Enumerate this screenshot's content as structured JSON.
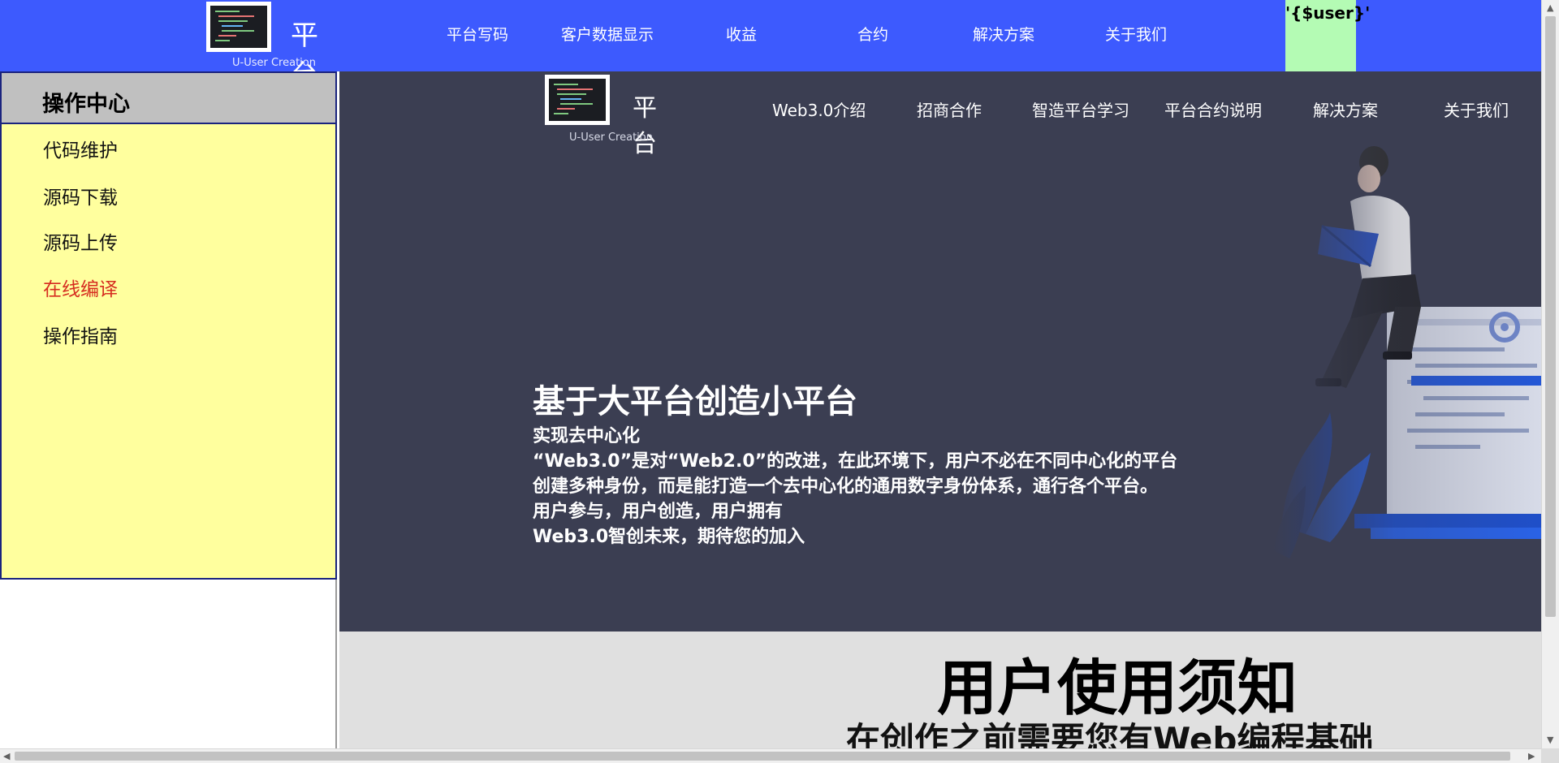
{
  "topbar": {
    "logo": {
      "title": "平台",
      "subtitle": "U-User Creation"
    },
    "nav": [
      {
        "label": "平台写码"
      },
      {
        "label": "客户数据显示"
      },
      {
        "label": "收益"
      },
      {
        "label": "合约"
      },
      {
        "label": "解决方案"
      },
      {
        "label": "关于我们"
      }
    ],
    "user_placeholder": "'{$user}'"
  },
  "sidebar": {
    "header": "操作中心",
    "items": [
      {
        "label": "代码维护"
      },
      {
        "label": "源码下载"
      },
      {
        "label": "源码上传"
      },
      {
        "label": "在线编译",
        "active": true
      },
      {
        "label": "操作指南"
      }
    ]
  },
  "hero": {
    "logo": {
      "title": "平台",
      "subtitle": "U-User Creation"
    },
    "nav": [
      {
        "label": "Web3.0介绍"
      },
      {
        "label": "招商合作"
      },
      {
        "label": "智造平台学习"
      },
      {
        "label": "平台合约说明"
      },
      {
        "label": "解决方案"
      },
      {
        "label": "关于我们"
      }
    ],
    "title": "基于大平台创造小平台",
    "lines": [
      "实现去中心化",
      "“Web3.0”是对“Web2.0”的改进，在此环境下，用户不必在不同中心化的平台",
      "创建多种身份，而是能打造一个去中心化的通用数字身份体系，通行各个平台。",
      "用户参与，用户创造，用户拥有",
      "Web3.0智创未来，期待您的加入"
    ]
  },
  "notice": {
    "title": "用户使用须知",
    "subtitle": "在创作之前需要您有Web编程基础"
  },
  "colors": {
    "topbar": "#3d5afe",
    "sidebar_bg": "#ffff9e",
    "active_item": "#d62d20",
    "hero_bg": "#3b3e52",
    "user_box": "#b4fbb4"
  }
}
